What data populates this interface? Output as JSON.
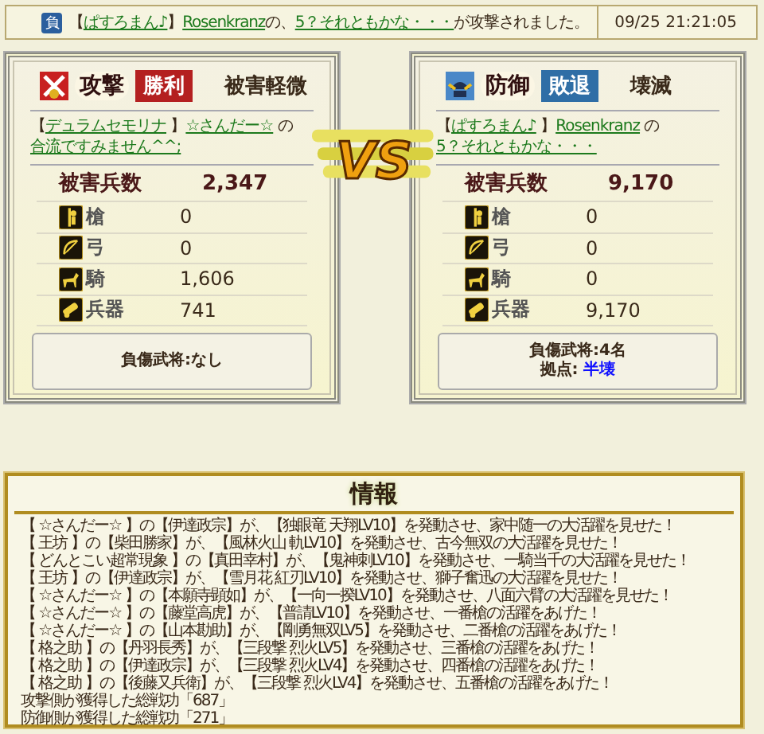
{
  "notice": {
    "badge": "負",
    "segments": [
      {
        "kind": "plain",
        "text": "【"
      },
      {
        "kind": "link",
        "text": "ぱすろまん♪"
      },
      {
        "kind": "plain",
        "text": "】"
      },
      {
        "kind": "link",
        "text": "Rosenkranz"
      },
      {
        "kind": "plain",
        "text": "の、"
      },
      {
        "kind": "link",
        "text": "5？それともかな・・・"
      },
      {
        "kind": "plain",
        "text": "が攻撃されました。"
      }
    ],
    "time": "09/25 21:21:05"
  },
  "vs_label": "VS",
  "sides": [
    {
      "kind": "attack",
      "label": "攻撃",
      "won": true,
      "result": "勝利",
      "damage": "被害軽微",
      "segments": [
        {
          "kind": "plain",
          "text": "【"
        },
        {
          "kind": "link",
          "text": "デュラムセモリナ"
        },
        {
          "kind": "plain",
          "text": " 】"
        },
        {
          "kind": "link",
          "text": "☆さんだー☆"
        },
        {
          "kind": "plain",
          "text": " の"
        },
        {
          "kind": "link",
          "text": "合流ですみません^^;"
        }
      ],
      "total_label": "被害兵数",
      "total": "2,347",
      "units": [
        {
          "kind": "spear",
          "label": "槍",
          "value": "0"
        },
        {
          "kind": "bow",
          "label": "弓",
          "value": "0"
        },
        {
          "kind": "horse",
          "label": "騎",
          "value": "1,606"
        },
        {
          "kind": "siege",
          "label": "兵器",
          "value": "741"
        }
      ],
      "summary": [
        "負傷武将:なし"
      ]
    },
    {
      "kind": "defense",
      "label": "防御",
      "won": false,
      "result": "敗退",
      "damage": "壊滅",
      "segments": [
        {
          "kind": "plain",
          "text": "【"
        },
        {
          "kind": "link",
          "text": "ぱすろまん♪"
        },
        {
          "kind": "plain",
          "text": " 】"
        },
        {
          "kind": "link",
          "text": "Rosenkranz"
        },
        {
          "kind": "plain",
          "text": " の"
        },
        {
          "kind": "link",
          "text": "5？それともかな・・・"
        }
      ],
      "total_label": "被害兵数",
      "total": "9,170",
      "units": [
        {
          "kind": "spear",
          "label": "槍",
          "value": "0"
        },
        {
          "kind": "bow",
          "label": "弓",
          "value": "0"
        },
        {
          "kind": "horse",
          "label": "騎",
          "value": "0"
        },
        {
          "kind": "siege",
          "label": "兵器",
          "value": "9,170"
        }
      ],
      "summary": [
        "負傷武将:4名",
        "拠点: **半壊**"
      ]
    }
  ],
  "info": {
    "title": "情報",
    "lines": [
      "【 ☆さんだー☆ 】の【伊達政宗】が、【独眼竜 天翔LV10】を発動させ、家中随一の大活躍を見せた！",
      "【 王坊 】の【柴田勝家】が、【風林火山 軌LV10】を発動させ、古今無双の大活躍を見せた！",
      "【 どんとこい超常現象 】の【真田幸村】が、【鬼神刺LV10】を発動させ、一騎当千の大活躍を見せた！",
      "【 王坊 】の【伊達政宗】が、【雪月花 紅刃LV10】を発動させ、獅子奮迅の大活躍を見せた！",
      "【 ☆さんだー☆ 】の【本願寺顕如】が、【一向一揆LV10】を発動させ、八面六臂の大活躍を見せた！",
      "【 ☆さんだー☆ 】の【藤堂高虎】が、【普請LV10】を発動させ、一番槍の活躍をあげた！",
      "【 ☆さんだー☆ 】の【山本勘助】が、【剛勇無双LV5】を発動させ、二番槍の活躍をあげた！",
      "【 格之助 】の【丹羽長秀】が、【三段撃 烈火LV5】を発動させ、三番槍の活躍をあげた！",
      "【 格之助 】の【伊達政宗】が、【三段撃 烈火LV4】を発動させ、四番槍の活躍をあげた！",
      "【 格之助 】の【後藤又兵衛】が、【三段撃 烈火LV4】を発動させ、五番槍の活躍をあげた！",
      "攻撃側が獲得した総戦功「687」",
      "防御側が獲得した総戦功「271」"
    ]
  }
}
